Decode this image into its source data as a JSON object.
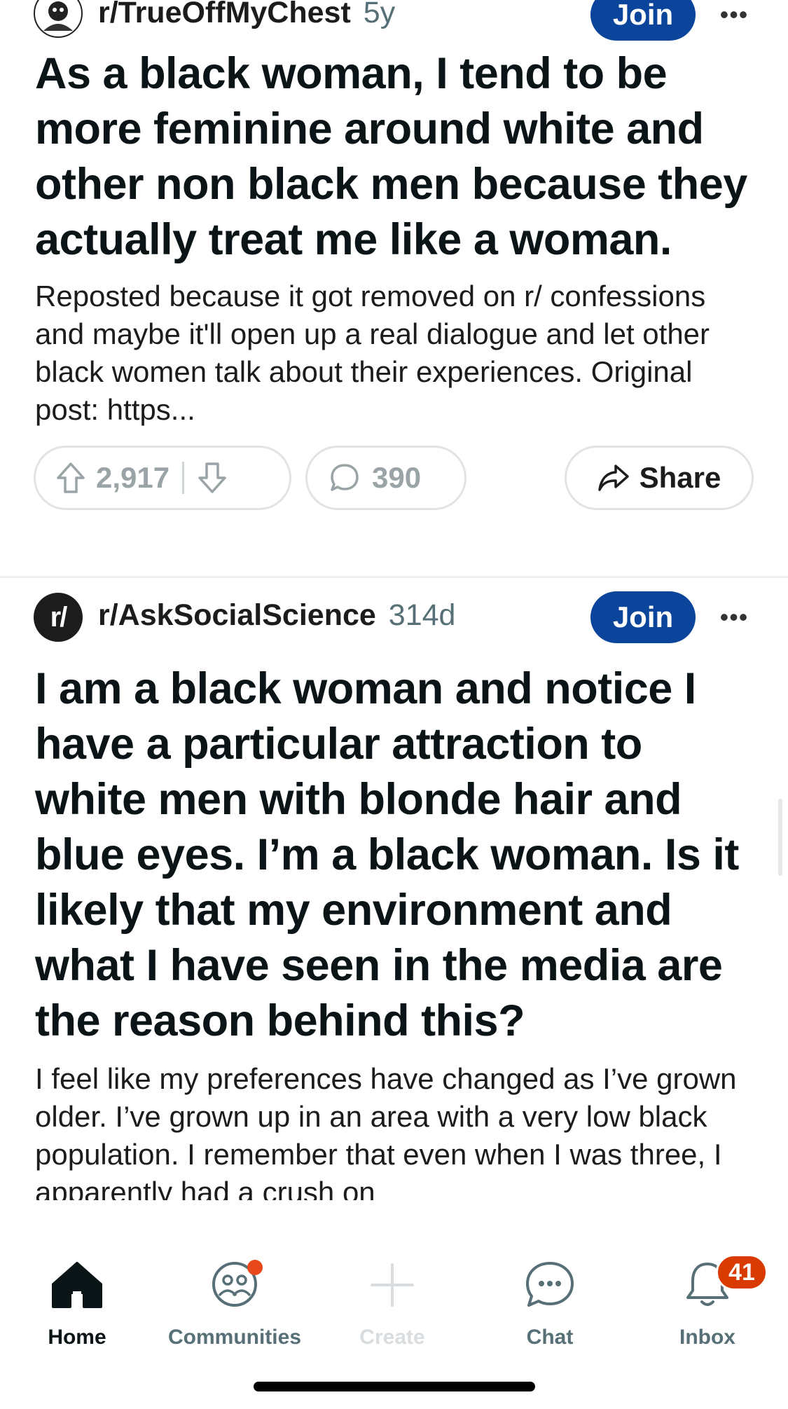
{
  "feed": {
    "posts": [
      {
        "subreddit": "r/TrueOffMyChest",
        "age": "5y",
        "join_label": "Join",
        "more_label": "•••",
        "title": "As a black woman, I tend to be more feminine around white and other non black men because they actually treat me like a woman.",
        "body": "Reposted because it got removed on r/ confessions and maybe it'll open up a real dialogue and let other black women talk about their experiences. Original post: https...",
        "upvotes": "2,917",
        "comments": "390",
        "share_label": "Share"
      },
      {
        "subreddit": "r/AskSocialScience",
        "age": "314d",
        "avatar_text": "r/",
        "join_label": "Join",
        "more_label": "•••",
        "title": "I am a black woman and notice I have a particular attraction to white men with blonde hair and blue eyes. I’m a black woman. Is it likely that my environment and what I have seen in the media are the reason behind this?",
        "body": "I feel like my preferences have changed as I’ve grown older. I’ve grown up in an area with a very low black population. I remember that even when I was three, I apparently had a crush on"
      }
    ]
  },
  "tabbar": {
    "home": "Home",
    "communities": "Communities",
    "create": "Create",
    "chat": "Chat",
    "inbox": "Inbox",
    "inbox_badge": "41"
  },
  "colors": {
    "join_button": "#0a449b",
    "badge": "#d93a00",
    "notification_dot": "#e8491c"
  }
}
